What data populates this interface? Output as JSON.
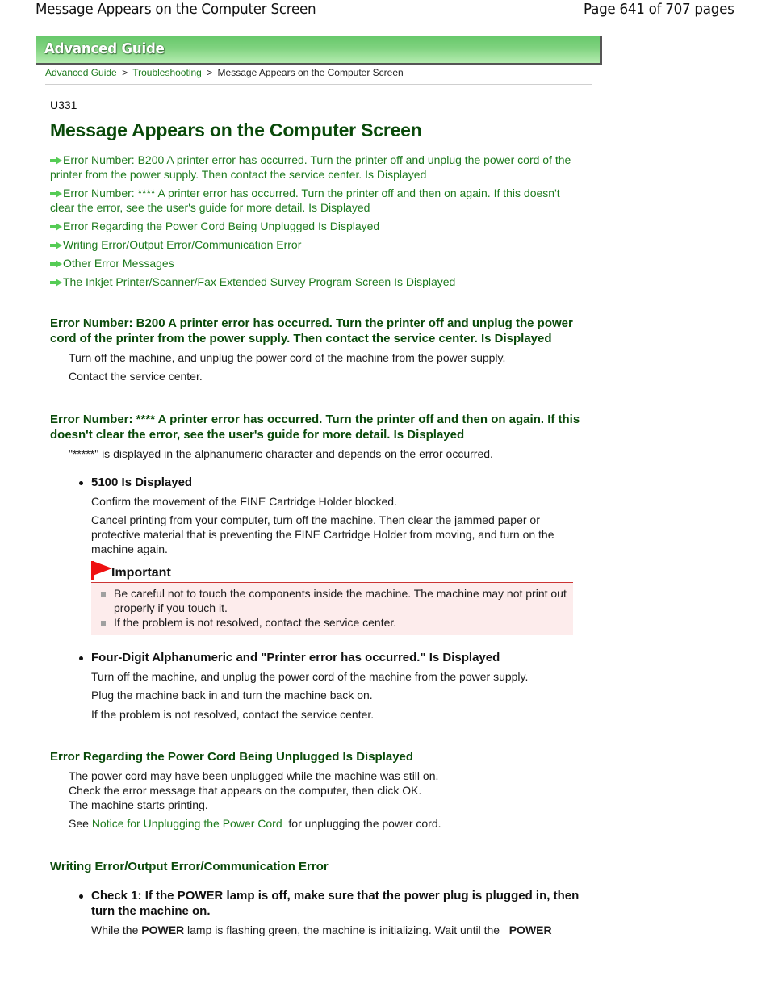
{
  "header": {
    "doc_title": "Message Appears on the Computer Screen",
    "page_indicator": "Page 641 of 707 pages"
  },
  "banner": {
    "label": "Advanced Guide"
  },
  "breadcrumb": {
    "items": [
      {
        "label": "Advanced Guide",
        "link": true
      },
      {
        "label": "Troubleshooting",
        "link": true
      },
      {
        "label": "Message Appears on the Computer Screen",
        "link": false
      }
    ],
    "separator": ">"
  },
  "page": {
    "code": "U331",
    "title": "Message Appears on the Computer Screen"
  },
  "toc": [
    {
      "label": "Error Number: B200 A printer error has occurred. Turn the printer off and unplug the power cord of the printer from the power supply. Then contact the service center. Is Displayed",
      "icon": "arrow-right-icon"
    },
    {
      "label": "Error Number: **** A printer error has occurred. Turn the printer off and then on again. If this doesn't clear the error, see the user's guide for more detail. Is Displayed",
      "icon": "arrow-right-icon"
    },
    {
      "label": "Error Regarding the Power Cord Being Unplugged Is Displayed",
      "icon": "arrow-right-icon"
    },
    {
      "label": "Writing Error/Output Error/Communication Error",
      "icon": "arrow-right-icon"
    },
    {
      "label": "Other Error Messages",
      "icon": "arrow-right-icon"
    },
    {
      "label": "The Inkjet Printer/Scanner/Fax Extended Survey Program Screen Is Displayed",
      "icon": "arrow-right-icon"
    }
  ],
  "sections": {
    "b200": {
      "heading": "Error Number: B200 A printer error has occurred. Turn the printer off and unplug the power cord of the printer from the power supply. Then contact the service center. Is Displayed",
      "paragraphs": [
        "Turn off the machine, and unplug the power cord of the machine from the power supply.",
        "Contact the service center."
      ]
    },
    "stars": {
      "heading": "Error Number: **** A printer error has occurred. Turn the printer off and then on again. If this doesn't clear the error, see the user's guide for more detail. Is Displayed",
      "intro": "\"*****\" is displayed in the alphanumeric character and depends on the error occurred.",
      "sub1": {
        "heading": "5100 Is Displayed",
        "paragraphs": [
          "Confirm the movement of the FINE Cartridge Holder blocked.",
          "Cancel printing from your computer, turn off the machine. Then clear the jammed paper or protective material that is preventing the FINE Cartridge Holder from moving, and turn on the machine again."
        ],
        "important": {
          "title": "Important",
          "items": [
            "Be careful not to touch the components inside the machine. The machine may not print out properly if you touch it.",
            "If the problem is not resolved, contact the service center."
          ]
        }
      },
      "sub2": {
        "heading": "Four-Digit Alphanumeric and \"Printer error has occurred.\" Is Displayed",
        "paragraphs": [
          "Turn off the machine, and unplug the power cord of the machine from the power supply.",
          "Plug the machine back in and turn the machine back on.",
          "If the problem is not resolved, contact the service center."
        ]
      }
    },
    "power_cord": {
      "heading": "Error Regarding the Power Cord Being Unplugged Is Displayed",
      "lines": [
        "The power cord may have been unplugged while the machine was still on.",
        "Check the error message that appears on the computer, then click OK.",
        "The machine starts printing."
      ],
      "see_prefix": "See",
      "see_link": "Notice for Unplugging the Power Cord",
      "see_suffix": "for unplugging the power cord."
    },
    "writing_error": {
      "heading": "Writing Error/Output Error/Communication Error",
      "check1": {
        "heading": "Check 1: If the POWER lamp is off, make sure that the power plug is plugged in, then turn the machine on.",
        "text_parts": [
          "While the",
          "POWER",
          "lamp is flashing green, the machine is initializing. Wait until the",
          "POWER"
        ]
      }
    }
  },
  "colors": {
    "link_green": "#1d7a1d",
    "heading_green": "#0a4a0a",
    "banner_green": "#66c86a",
    "important_red": "#cc3333",
    "important_bg": "#fdecec",
    "flag_red": "#ee1111",
    "arrow_green": "#55cc55"
  }
}
